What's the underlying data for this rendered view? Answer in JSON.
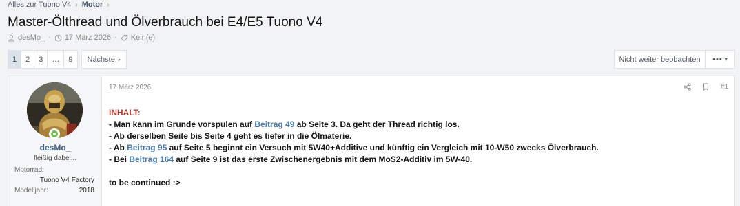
{
  "breadcrumb": {
    "item1": "Alles zur Tuono V4",
    "item2": "Motor",
    "sep": "›"
  },
  "thread": {
    "title": "Master-Ölthread und Ölverbrauch bei E4/E5 Tuono V4",
    "author": "desMo_",
    "date": "17 März 2026",
    "tags": "Kein(e)"
  },
  "pagination": {
    "pages": [
      "1",
      "2",
      "3",
      "…",
      "9"
    ],
    "active": "1",
    "next_label": "Nächste",
    "next_arrow": "▸"
  },
  "actions": {
    "watch_label": "Nicht weiter beobachten",
    "more_dots": "•••",
    "more_caret": "▾"
  },
  "post": {
    "date": "17 März 2026",
    "number": "#1",
    "user": {
      "name": "desMo_",
      "title": "fleißig dabei...",
      "field1_label": "Motorrad:",
      "field1_value": "Tuono V4 Factory",
      "field2_label": "Modelljahr:",
      "field2_value": "2018"
    },
    "body": {
      "heading": "INHALT:",
      "l1_a": "- Man kann im Grunde vorspulen auf ",
      "l1_link": "Beitrag 49",
      "l1_b": " ab Seite 3. Da geht der Thread richtig los.",
      "l2": "- Ab derselben Seite bis Seite 4 geht es tiefer in die Ölmaterie.",
      "l3_a": "- Ab ",
      "l3_link": "Beitrag 95",
      "l3_b": " auf Seite 5 beginnt ein Versuch mit 5W40+Additive und künftig ein Vergleich mit 10-W50 zwecks Ölverbrauch.",
      "l4_a": "- Bei ",
      "l4_link": "Beitrag 164",
      "l4_b": " auf Seite 9 ist das erste Zwischenergebnis mit dem MoS2-Additiv im 5W-40.",
      "closing": "to be continued :>"
    }
  },
  "icons": {
    "user": "user-icon",
    "clock": "clock-icon",
    "tag": "tag-icon",
    "share": "share-icon",
    "bookmark": "bookmark-icon"
  },
  "colors": {
    "link": "#4a79a5",
    "heading": "#b0392c",
    "username": "#3d5f82",
    "online": "#6cc04a"
  }
}
